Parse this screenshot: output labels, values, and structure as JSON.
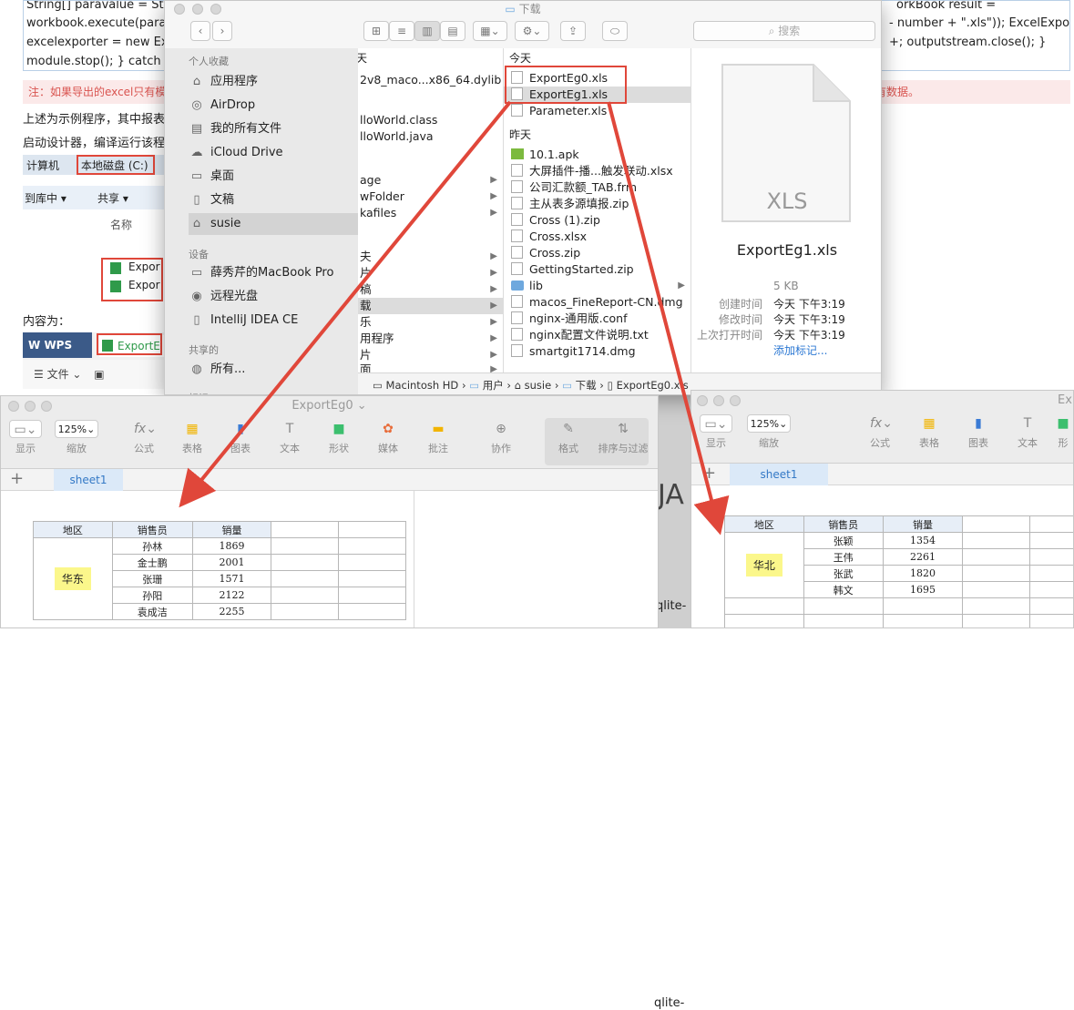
{
  "doc": {
    "code_line1_left": "String[] paravalue = Stable",
    "code_line1_right": "orkBook result =",
    "code_line2_left": "workbook.execute(paramap",
    "code_line2_right": "- number + \".xls\")); ExcelExporter",
    "code_line3_left": "excelexporter = new ExcelE",
    "code_line3_right": "+; outputstream.close(); }",
    "code_line4_left": "module.stop(); } catch (Exc",
    "note_left": "注：如果导出的excel只有模板",
    "note_right": "有数据。",
    "text1": "上述为示例程序，其中报表",
    "text2": "启动设计器，编译运行该程序",
    "text3": "内容为：",
    "win_breadcrumb": [
      "计算机",
      "本地磁盘 (C:)"
    ],
    "win_toolbar": [
      "到库中 ▾",
      "共享 ▾"
    ],
    "win_header": "名称",
    "win_files": [
      "Expor",
      "Expor"
    ],
    "wps_label": "WPS",
    "wps_file": "ExportE",
    "wps_menu": "文件"
  },
  "finder": {
    "title": "下载",
    "search_placeholder": "搜索",
    "sidebar": {
      "favorites_header": "个人收藏",
      "favorites": [
        "应用程序",
        "AirDrop",
        "我的所有文件",
        "iCloud Drive",
        "桌面",
        "文稿",
        "susie"
      ],
      "devices_header": "设备",
      "devices": [
        "薛秀芹的MacBook Pro",
        "远程光盘",
        "IntelliJ IDEA CE"
      ],
      "shared_header": "共享的",
      "shared": [
        "所有..."
      ],
      "tags_header": "标记"
    },
    "col1": [
      "2v8_maco...x86_64.dylib",
      "lloWorld.class",
      "lloWorld.java",
      "age",
      "wFolder",
      "kafiles"
    ],
    "col2": [
      "夫",
      "片",
      "稿",
      "载",
      "乐",
      "用程序",
      "片",
      "面"
    ],
    "col3": {
      "today_header": "今天",
      "today": [
        "ExportEg0.xls",
        "ExportEg1.xls",
        "Parameter.xls"
      ],
      "yesterday_header": "昨天",
      "yesterday": [
        "10.1.apk",
        "大屏插件-播...触发联动.xlsx",
        "公司汇款额_TAB.frm",
        "主从表多源填报.zip",
        "Cross (1).zip",
        "Cross.xlsx",
        "Cross.zip",
        "GettingStarted.zip",
        "lib",
        "macos_FineReport-CN.dmg",
        "nginx-通用版.conf",
        "nginx配置文件说明.txt",
        "smartgit1714.dmg"
      ]
    },
    "preview": {
      "icon_label": "XLS",
      "filename": "ExportEg1.xls",
      "size": "5 KB",
      "created_label": "创建时间",
      "created": "今天 下午3:19",
      "modified_label": "修改时间",
      "modified": "今天 下午3:19",
      "opened_label": "上次打开时间",
      "opened": "今天 下午3:19",
      "add_tags": "添加标记..."
    },
    "path": [
      "Macintosh HD",
      "用户",
      "susie",
      "下载",
      "ExportEg0.xls"
    ]
  },
  "numbers_left": {
    "title": "ExportEg0 ⌄",
    "zoom": "125%",
    "tools": [
      "显示",
      "缩放",
      "公式",
      "表格",
      "图表",
      "文本",
      "形状",
      "媒体",
      "批注",
      "协作",
      "格式",
      "排序与过滤"
    ],
    "sheet": "sheet1",
    "headers": [
      "地区",
      "销售员",
      "销量"
    ],
    "region": "华东",
    "rows": [
      [
        "孙林",
        "1869"
      ],
      [
        "金士鹏",
        "2001"
      ],
      [
        "张珊",
        "1571"
      ],
      [
        "孙阳",
        "2122"
      ],
      [
        "袁成洁",
        "2255"
      ]
    ]
  },
  "numbers_right": {
    "title": "Exp",
    "zoom": "125%",
    "tools": [
      "显示",
      "缩放",
      "公式",
      "表格",
      "图表",
      "文本",
      "形"
    ],
    "sheet": "sheet1",
    "headers": [
      "地区",
      "销售员",
      "销量"
    ],
    "region": "华北",
    "rows": [
      [
        "张颖",
        "1354"
      ],
      [
        "王伟",
        "2261"
      ],
      [
        "张武",
        "1820"
      ],
      [
        "韩文",
        "1695"
      ]
    ]
  },
  "bg_fragments": {
    "ja": "JA",
    "sqlite": "qlite-"
  },
  "colors": {
    "arrow": "#e0473a",
    "sheet_tab": "#dbe9f8",
    "highlight": "#fbf78b"
  }
}
